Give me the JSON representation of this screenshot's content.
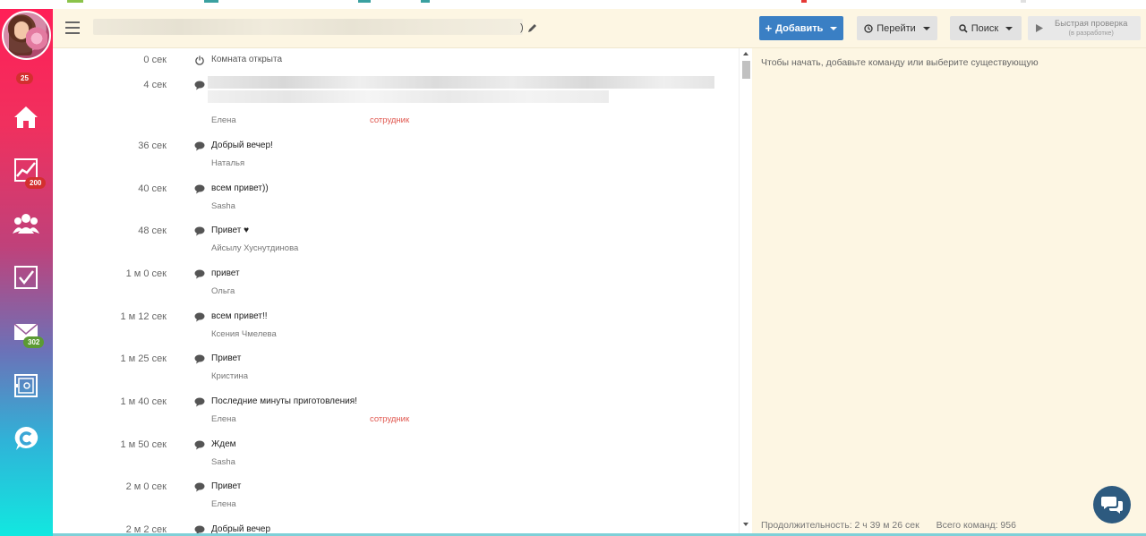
{
  "sidebar": {
    "avatar_badge": "25",
    "items": [
      {
        "name": "home",
        "badge": ""
      },
      {
        "name": "analytics",
        "badge": "200"
      },
      {
        "name": "users",
        "badge": ""
      },
      {
        "name": "tasks",
        "badge": ""
      },
      {
        "name": "mail",
        "badge": "302"
      },
      {
        "name": "safe",
        "badge": ""
      },
      {
        "name": "chat",
        "badge": ""
      }
    ]
  },
  "header": {
    "title_end": ")",
    "add_label": "Добавить",
    "go_label": "Перейти",
    "search_label": "Поиск",
    "quick_check_label": "Быстрая проверка",
    "quick_check_sub": "(в разработке)"
  },
  "log": [
    {
      "time": "0 сек",
      "type": "power",
      "text": "Комната открыта",
      "author": "",
      "role": ""
    },
    {
      "time": "4 сек",
      "type": "comment",
      "text": "",
      "author": "Елена",
      "role": "сотрудник"
    },
    {
      "time": "36 сек",
      "type": "comment",
      "text": "Добрый вечер!",
      "author": "Наталья",
      "role": ""
    },
    {
      "time": "40 сек",
      "type": "comment",
      "text": "всем привет))",
      "author": "Sasha",
      "role": ""
    },
    {
      "time": "48 сек",
      "type": "comment",
      "text": "Привет ♥",
      "author": "Айсылу Хуснутдинова",
      "role": ""
    },
    {
      "time": "1 м 0 сек",
      "type": "comment",
      "text": "привет",
      "author": "Ольга",
      "role": ""
    },
    {
      "time": "1 м 12 сек",
      "type": "comment",
      "text": "всем привет!!",
      "author": "Ксения Чмелева",
      "role": ""
    },
    {
      "time": "1 м 25 сек",
      "type": "comment",
      "text": "Привет",
      "author": "Кристина",
      "role": ""
    },
    {
      "time": "1 м 40 сек",
      "type": "comment",
      "text": "Последние минуты приготовления!",
      "author": "Елена",
      "role": "сотрудник"
    },
    {
      "time": "1 м 50 сек",
      "type": "comment",
      "text": "Ждем",
      "author": "Sasha",
      "role": ""
    },
    {
      "time": "2 м 0 сек",
      "type": "comment",
      "text": "Привет",
      "author": "Елена",
      "role": ""
    },
    {
      "time": "2 м 2 сек",
      "type": "comment",
      "text": "Добрый вечер",
      "author": "",
      "role": ""
    }
  ],
  "panel": {
    "hint": "Чтобы начать, добавьте команду или выберите существующую",
    "duration": "Продолжительность: 2 ч 39 м 26 сек",
    "total": "Всего команд: 956"
  },
  "colors": {
    "accent": "#3a7fc4",
    "panel_bg": "#fdf6e3",
    "role_color": "#e0564e",
    "fab": "#2d5a7f"
  }
}
